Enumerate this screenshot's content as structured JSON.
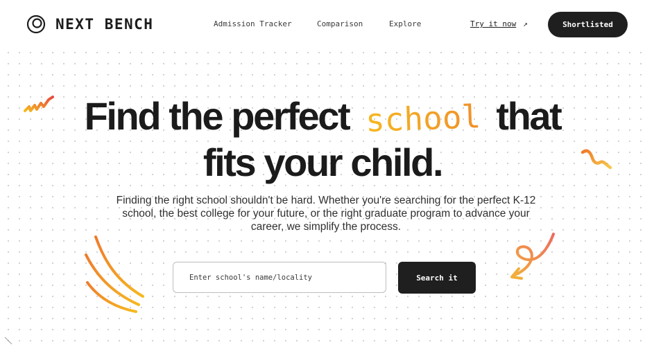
{
  "brand": {
    "name": "NEXT BENCH",
    "logo_icon": "concentric-circle-logo-icon"
  },
  "nav": {
    "items": [
      {
        "label": "Admission Tracker"
      },
      {
        "label": "Comparison"
      },
      {
        "label": "Explore"
      }
    ],
    "try_label": "Try it now",
    "try_icon": "arrow-up-right-icon",
    "try_arrow": "↗",
    "shortlisted_label": "Shortlisted"
  },
  "hero": {
    "headline_before": "Find the perfect",
    "headline_highlight": "school",
    "headline_after": "that",
    "headline_line2": "fits your child.",
    "subtext": "Finding the right school shouldn't be hard. Whether you're searching for the perfect K-12 school, the best college for your future, or the right graduate program to advance your career, we simplify the process."
  },
  "search": {
    "placeholder": "Enter school's name/locality",
    "value": "",
    "button_label": "Search it"
  },
  "colors": {
    "accent_orange": "#ef8a2c",
    "accent_yellow": "#f6b820",
    "dark": "#1f1f1f",
    "coral": "#ee7b5f"
  }
}
